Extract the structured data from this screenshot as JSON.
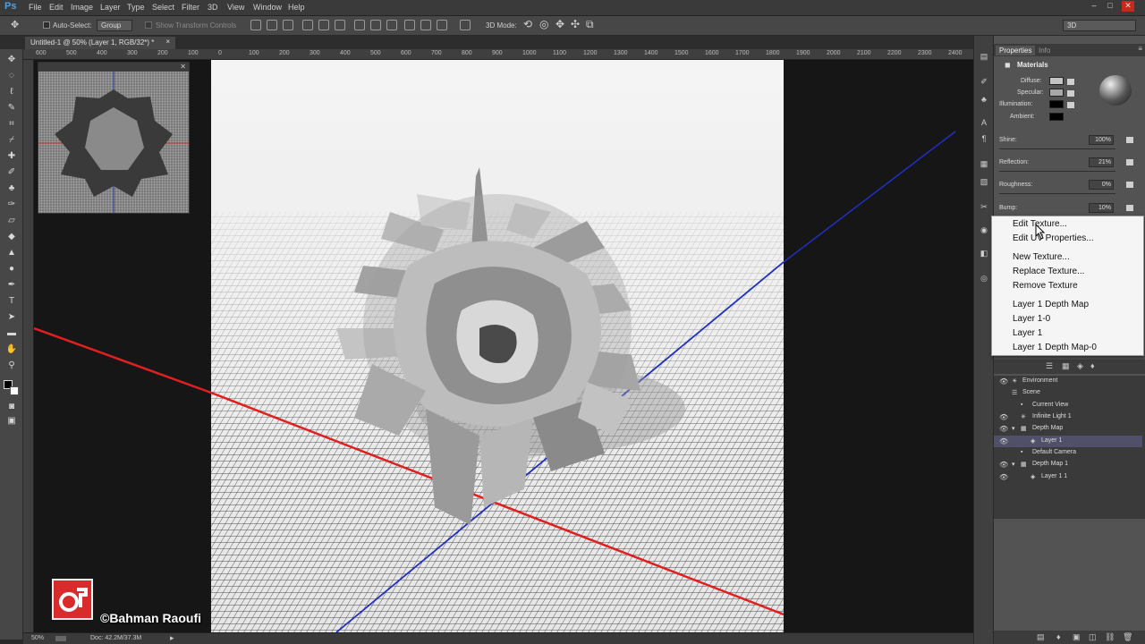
{
  "app": {
    "logo": "Ps"
  },
  "menu": [
    "File",
    "Edit",
    "Image",
    "Layer",
    "Type",
    "Select",
    "Filter",
    "3D",
    "View",
    "Window",
    "Help"
  ],
  "window_controls": [
    "–",
    "□",
    "✕"
  ],
  "options": {
    "auto_select_label": "Auto-Select:",
    "auto_select_value": "Group",
    "show_transform_controls": "Show Transform Controls",
    "mode_3d_label": "3D Mode:",
    "workspace": "3D"
  },
  "document": {
    "tab_title": "Untitled-1 @ 50% (Layer 1, RGB/32*) *",
    "close": "×"
  },
  "hruler_ticks": [
    "600",
    "500",
    "400",
    "300",
    "200",
    "100",
    "0",
    "100",
    "200",
    "300",
    "400",
    "500",
    "600",
    "700",
    "800",
    "900",
    "1000",
    "1100",
    "1200",
    "1300",
    "1400",
    "1500",
    "1600",
    "1700",
    "1800",
    "1900",
    "2000",
    "2100",
    "2200",
    "2300",
    "2400"
  ],
  "status": {
    "zoom": "50%",
    "doc": "Doc: 42.2M/37.3M"
  },
  "properties": {
    "tabs": [
      "Properties",
      "Info"
    ],
    "section": "Materials",
    "colors": [
      {
        "label": "Diffuse:",
        "color": "#c4c4c4"
      },
      {
        "label": "Specular:",
        "color": "#a8a8a8"
      },
      {
        "label": "Illumination:",
        "color": "#000000"
      },
      {
        "label": "Ambient:",
        "color": "#000000"
      }
    ],
    "sliders": [
      {
        "label": "Shine:",
        "value": "100%"
      },
      {
        "label": "Reflection:",
        "value": "21%"
      },
      {
        "label": "Roughness:",
        "value": "0%"
      },
      {
        "label": "Bump:",
        "value": "10%"
      }
    ]
  },
  "context_menu": {
    "group1": [
      "Edit Texture...",
      "Edit UV Properties..."
    ],
    "group2": [
      "New Texture...",
      "Replace Texture...",
      "Remove Texture"
    ],
    "group3": [
      "Layer 1 Depth Map",
      "Layer 1-0",
      "Layer 1",
      "Layer 1 Depth Map-0"
    ]
  },
  "scene": {
    "rows": [
      {
        "label": "Environment",
        "indent": 0
      },
      {
        "label": "Scene",
        "indent": 0
      },
      {
        "label": "Current View",
        "indent": 1
      },
      {
        "label": "Infinite Light 1",
        "indent": 1
      },
      {
        "label": "Depth Map",
        "indent": 1
      },
      {
        "label": "Layer 1",
        "indent": 2
      },
      {
        "label": "Default Camera",
        "indent": 1
      },
      {
        "label": "Depth Map 1",
        "indent": 1
      },
      {
        "label": "Layer 1 1",
        "indent": 2
      }
    ]
  },
  "watermark": {
    "text": "©Bahman Raoufi"
  },
  "colors": {
    "accent": "#4aa3e6",
    "axis_x": "#e02020",
    "axis_z": "#2020e0",
    "watermark_red": "#d92b2b"
  }
}
